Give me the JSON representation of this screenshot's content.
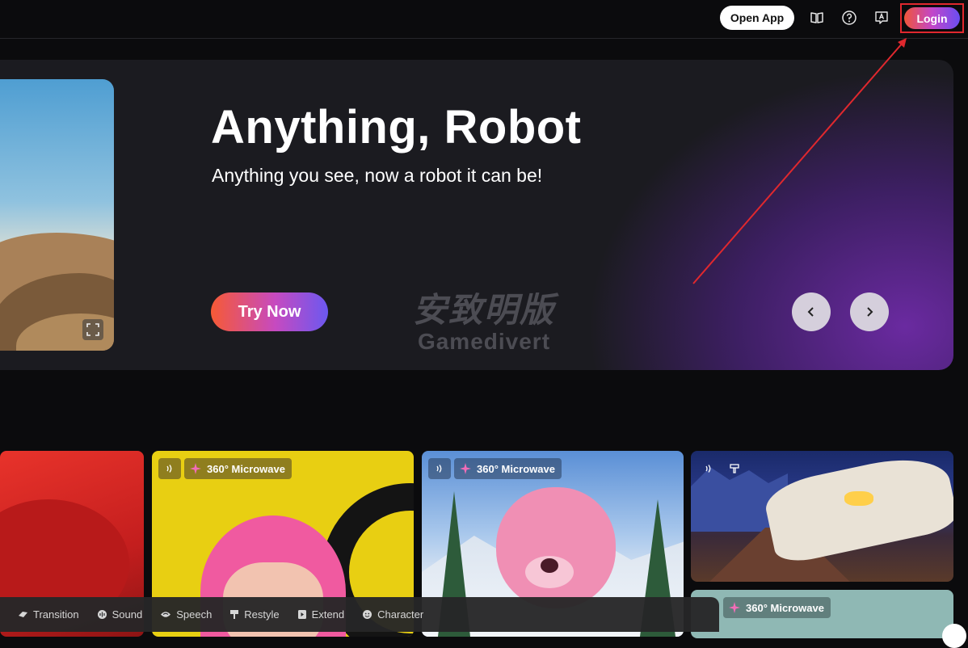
{
  "header": {
    "open_app_label": "Open App",
    "login_label": "Login",
    "icons": [
      "book-icon",
      "help-icon",
      "translate-icon"
    ]
  },
  "hero": {
    "title": "Anything, Robot",
    "subtitle": "Anything you see, now a robot it can be!",
    "cta_label": "Try Now",
    "prev_icon": "chevron-left-icon",
    "next_icon": "chevron-right-icon",
    "watermark_cn": "安致明版",
    "watermark_en": "Gamedivert"
  },
  "cards": [
    {
      "tag": ""
    },
    {
      "tag": "360° Microwave"
    },
    {
      "tag": "360° Microwave"
    },
    {
      "tag": ""
    },
    {
      "tag": "360° Microwave"
    }
  ],
  "toolbar": {
    "items": [
      {
        "label": "Transition",
        "icon": "transition-icon"
      },
      {
        "label": "Sound",
        "icon": "sound-icon"
      },
      {
        "label": "Speech",
        "icon": "speech-icon"
      },
      {
        "label": "Restyle",
        "icon": "restyle-icon"
      },
      {
        "label": "Extend",
        "icon": "extend-icon"
      },
      {
        "label": "Character",
        "icon": "character-icon"
      }
    ]
  },
  "colors": {
    "accent_gradient_start": "#f0563a",
    "accent_gradient_end": "#6a4df2",
    "annotation_red": "#e0282e"
  }
}
